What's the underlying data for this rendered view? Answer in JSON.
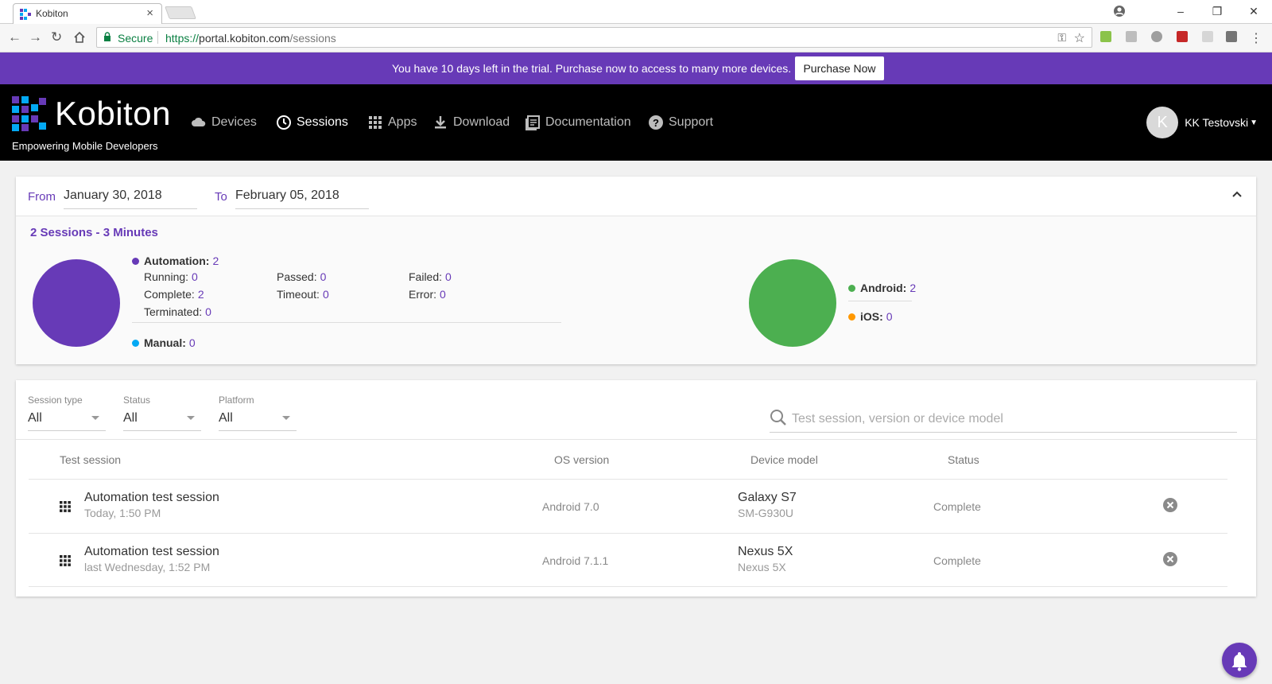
{
  "browser": {
    "tab_title": "Kobiton",
    "tab_close": "×",
    "window_buttons": [
      "‒",
      "❐",
      "✕"
    ],
    "secure_label": "Secure",
    "url_scheme": "https://",
    "url_host": "portal.kobiton.com",
    "url_path": "/sessions"
  },
  "trial_banner": {
    "message": "You have 10 days left in the trial. Purchase now to access to many more devices.",
    "button": "Purchase Now"
  },
  "header": {
    "brand": "Kobiton",
    "tagline": "Empowering Mobile Developers",
    "nav": [
      {
        "label": "Devices",
        "icon": "cloud-icon"
      },
      {
        "label": "Sessions",
        "icon": "clock-icon",
        "active": true
      },
      {
        "label": "Apps",
        "icon": "apps-grid-icon"
      },
      {
        "label": "Download",
        "icon": "download-icon"
      },
      {
        "label": "Documentation",
        "icon": "document-icon"
      },
      {
        "label": "Support",
        "icon": "help-icon"
      }
    ],
    "user": {
      "initial": "K",
      "name": "KK Testovski"
    },
    "accent_color": "#673ab7"
  },
  "summary": {
    "from_label": "From",
    "from_date": "January 30, 2018",
    "to_label": "To",
    "to_date": "February 05, 2018",
    "title": "2 Sessions - 3 Minutes",
    "automation_label": "Automation:",
    "automation_value": "2",
    "running_label": "Running:",
    "running_value": "0",
    "complete_label": "Complete:",
    "complete_value": "2",
    "terminated_label": "Terminated:",
    "terminated_value": "0",
    "passed_label": "Passed:",
    "passed_value": "0",
    "timeout_label": "Timeout:",
    "timeout_value": "0",
    "failed_label": "Failed:",
    "failed_value": "0",
    "error_label": "Error:",
    "error_value": "0",
    "manual_label": "Manual:",
    "manual_value": "0",
    "android_label": "Android:",
    "android_value": "2",
    "ios_label": "iOS:",
    "ios_value": "0",
    "colors": {
      "automation": "#673ab7",
      "manual": "#03a9f4",
      "android": "#4caf50",
      "ios": "#ff9800"
    }
  },
  "filters": {
    "session_type_label": "Session type",
    "session_type_value": "All",
    "status_label": "Status",
    "status_value": "All",
    "platform_label": "Platform",
    "platform_value": "All",
    "search_placeholder": "Test session, version or device model"
  },
  "table": {
    "headers": {
      "test_session": "Test session",
      "os_version": "OS version",
      "device_model": "Device model",
      "status": "Status"
    },
    "rows": [
      {
        "name": "Automation test session",
        "time": "Today, 1:50 PM",
        "os": "Android 7.0",
        "device": "Galaxy S7",
        "device_code": "SM-G930U",
        "status": "Complete"
      },
      {
        "name": "Automation test session",
        "time": "last Wednesday, 1:52 PM",
        "os": "Android 7.1.1",
        "device": "Nexus 5X",
        "device_code": "Nexus 5X",
        "status": "Complete"
      }
    ]
  }
}
